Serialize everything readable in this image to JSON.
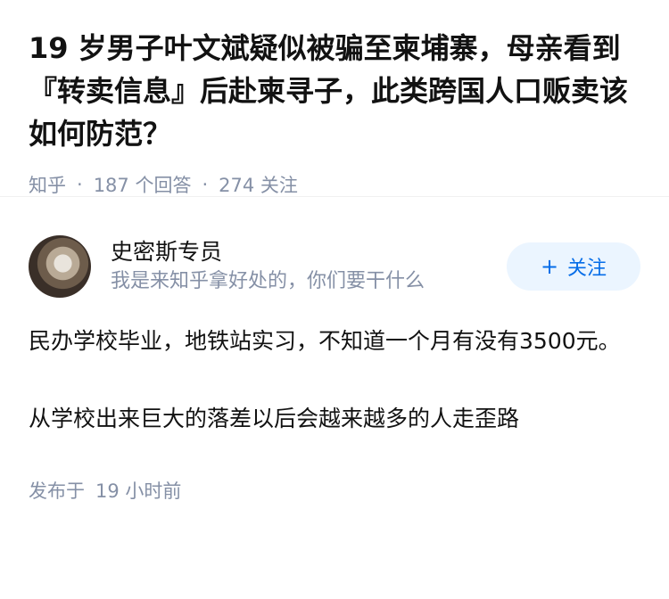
{
  "question": {
    "title": "19 岁男子叶文斌疑似被骗至柬埔寨，母亲看到『转卖信息』后赴柬寻子，此类跨国人口贩卖该如何防范？",
    "source": "知乎",
    "answer_count": "187 个回答",
    "follow_count": "274 关注"
  },
  "answer": {
    "author_name": "史密斯专员",
    "author_bio": "我是来知乎拿好处的，你们要干什么",
    "follow_label": "关注",
    "paragraphs": [
      "民办学校毕业，地铁站实习，不知道一个月有没有3500元。",
      "从学校出来巨大的落差以后会越来越多的人走歪路"
    ],
    "published_label": "发布于",
    "published_time": "19 小时前"
  },
  "icons": {
    "follow": "plus-icon",
    "avatar": "cat-avatar"
  },
  "colors": {
    "accent": "#056de8",
    "meta": "#8590a6",
    "button_bg": "#ebf5ff"
  }
}
